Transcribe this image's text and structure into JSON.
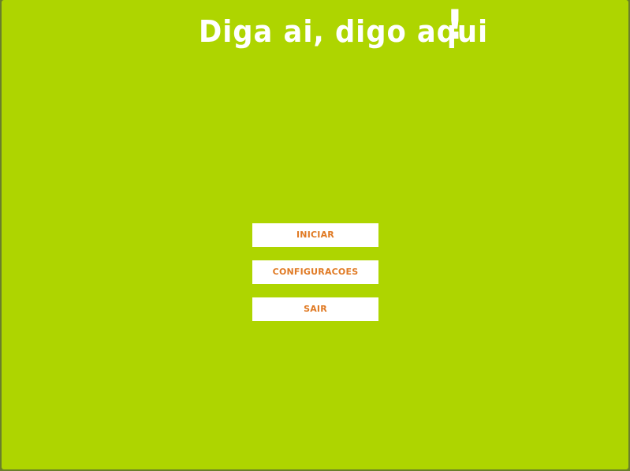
{
  "title": {
    "text": "Diga ai, digo aqui",
    "exclamation": "!"
  },
  "menu": {
    "items": [
      {
        "label": "INICIAR"
      },
      {
        "label": "CONFIGURACOES"
      },
      {
        "label": "SAIR"
      }
    ]
  },
  "colors": {
    "background": "#aed500",
    "title": "#ffffff",
    "button_bg": "#ffffff",
    "button_text": "#e07a24"
  }
}
